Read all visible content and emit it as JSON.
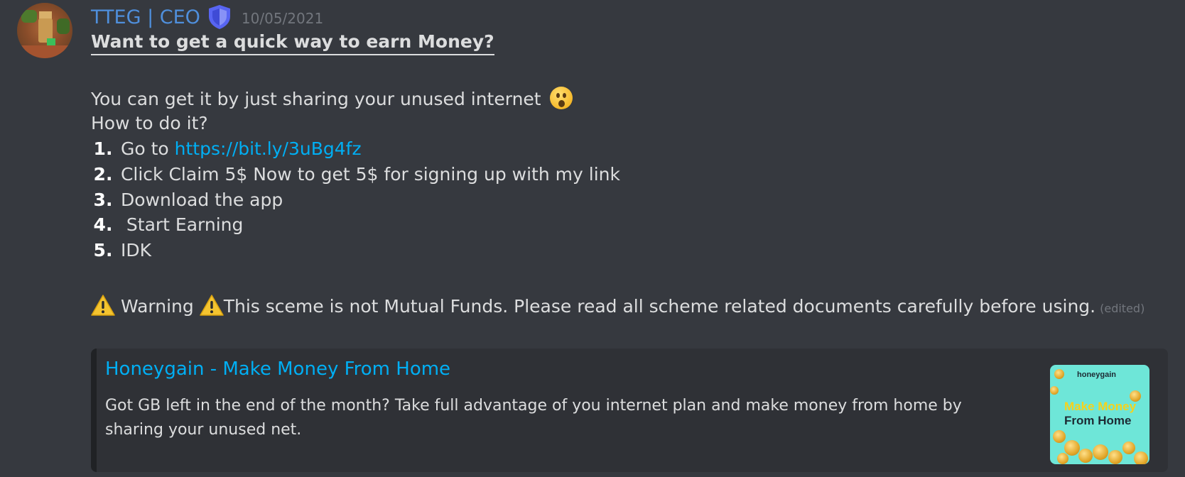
{
  "message": {
    "author": "TTEG | CEO",
    "timestamp": "10/05/2021",
    "title": "Want to get a quick way to earn Money?",
    "intro": "You can get it by just sharing your unused internet",
    "question": "How to do it?",
    "steps": [
      {
        "num": "1.",
        "prefix": "Go to ",
        "link": "https://bit.ly/3uBg4fz"
      },
      {
        "num": "2.",
        "text": "Click Claim 5$ Now to get 5$ for signing up with my link"
      },
      {
        "num": "3.",
        "text": "Download the app"
      },
      {
        "num": "4.",
        "text": " Start Earning"
      },
      {
        "num": "5.",
        "text": "IDK"
      }
    ],
    "warning_label": "Warning",
    "warning_text": "This sceme is not Mutual Funds. Please read all scheme related documents carefully before using.",
    "edited": "(edited)"
  },
  "embed": {
    "title": "Honeygain - Make Money From Home",
    "description": "Got GB left in the end of the month? Take full advantage of you internet plan and make money from home by sharing your unused net.",
    "thumbnail": {
      "brand": "honeygain",
      "line1": "Make Money",
      "line2": "From Home"
    }
  },
  "colors": {
    "background": "#36393f",
    "username": "#4f8fdc",
    "link": "#00aff4",
    "embed_background": "#2f3136",
    "thumbnail_background": "#6ee6d8"
  },
  "icons": {
    "role_badge": "shield-icon",
    "intro_emoji": "astonished-face-icon",
    "warning": "warning-icon"
  }
}
